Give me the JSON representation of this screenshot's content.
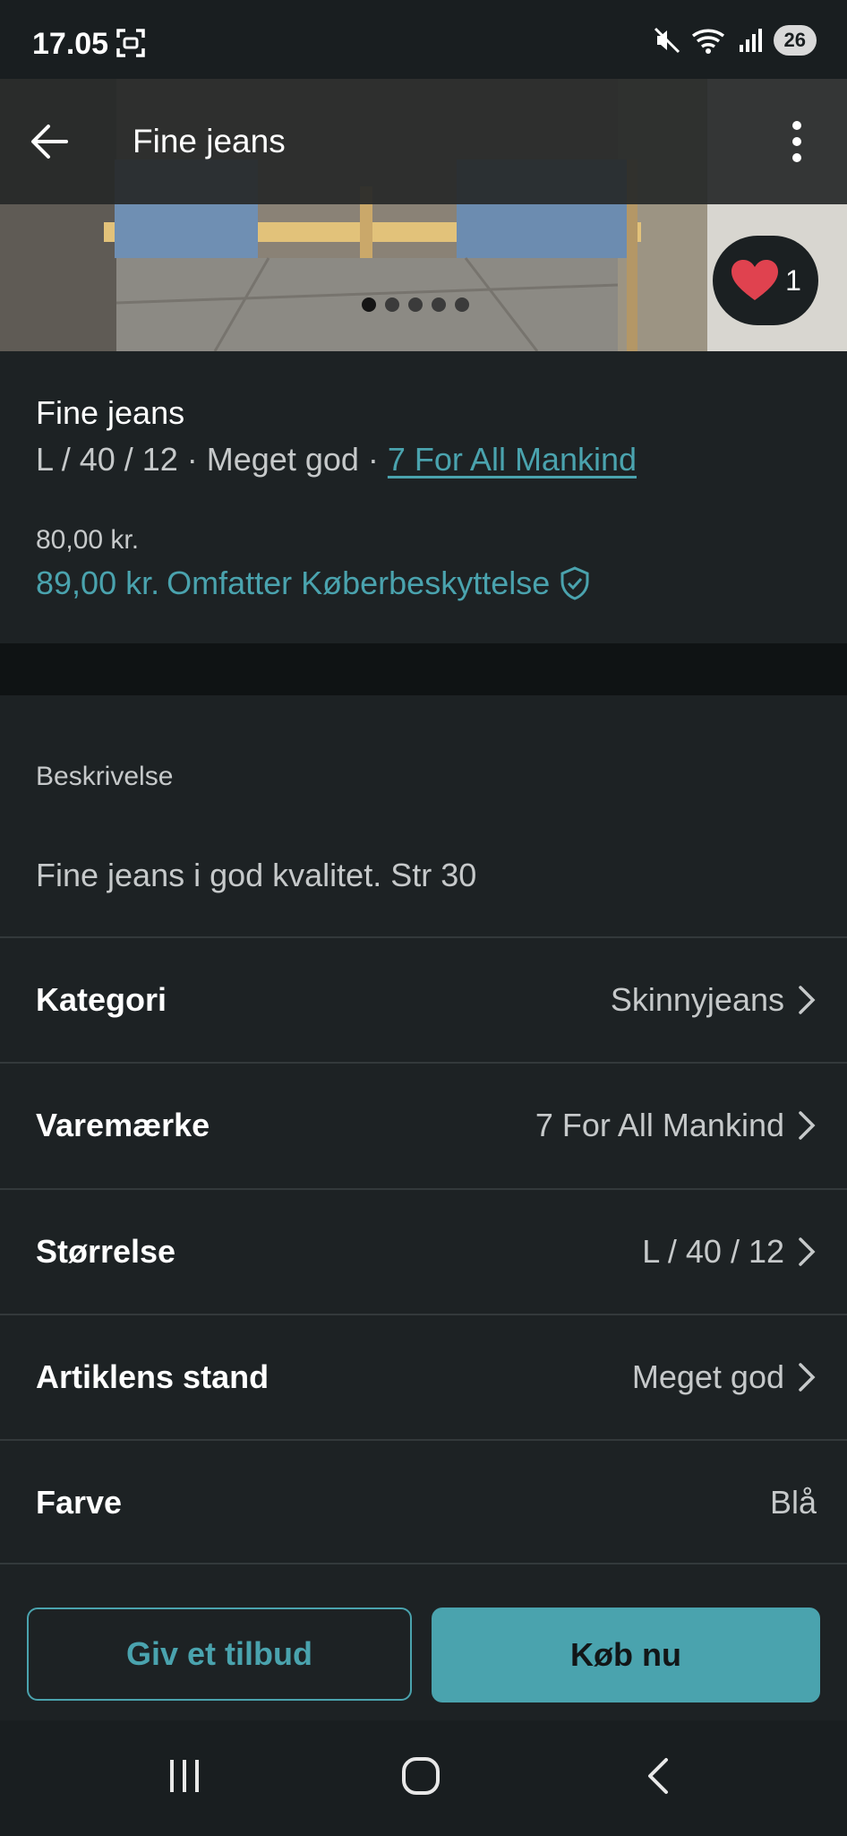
{
  "status_bar": {
    "time": "17.05",
    "battery": "26"
  },
  "header": {
    "title": "Fine jeans"
  },
  "gallery": {
    "image_count": 5,
    "active_index": 0,
    "likes": "1"
  },
  "product": {
    "title": "Fine jeans",
    "subtitle_prefix": "L / 40 / 12 · Meget god · ",
    "brand_link": "7 For All Mankind",
    "price": "80,00 kr.",
    "total_price": "89,00 kr.",
    "protection_text": "Omfatter Køberbeskyttelse"
  },
  "description": {
    "label": "Beskrivelse",
    "text": "Fine jeans i god kvalitet. Str 30"
  },
  "attributes": [
    {
      "label": "Kategori",
      "value": "Skinnyjeans"
    },
    {
      "label": "Varemærke",
      "value": "7 For All Mankind"
    },
    {
      "label": "Størrelse",
      "value": "L / 40 / 12"
    },
    {
      "label": "Artiklens stand",
      "value": "Meget god"
    },
    {
      "label": "Farve",
      "value": "Blå"
    }
  ],
  "actions": {
    "offer_label": "Giv et tilbud",
    "buy_label": "Køb nu"
  },
  "colors": {
    "accent": "#4aa3ae",
    "background": "#1d2224",
    "like_heart": "#e0424f"
  }
}
